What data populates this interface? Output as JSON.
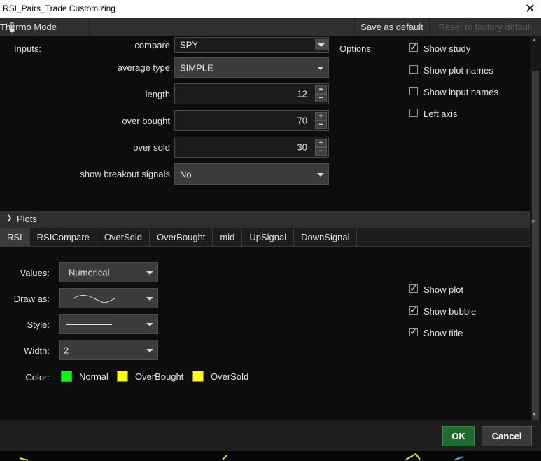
{
  "window": {
    "title": "RSI_Pairs_Trade Customizing",
    "close_glyph": "✕"
  },
  "toolbar": {
    "thermo_label": "Thermo Mode",
    "save_default_label": "Save as default",
    "reset_label": "Reset to factory default"
  },
  "inputs": {
    "section_label": "Inputs:",
    "compare": {
      "label": "compare",
      "value": "SPY"
    },
    "average_type": {
      "label": "average type",
      "value": "SIMPLE"
    },
    "length": {
      "label": "length",
      "value": "12"
    },
    "over_bought": {
      "label": "over bought",
      "value": "70"
    },
    "over_sold": {
      "label": "over sold",
      "value": "30"
    },
    "show_breakout_signals": {
      "label": "show breakout signals",
      "value": "No"
    }
  },
  "options": {
    "section_label": "Options:",
    "items": [
      {
        "label": "Show study",
        "checked": true
      },
      {
        "label": "Show plot names",
        "checked": false
      },
      {
        "label": "Show input names",
        "checked": false
      },
      {
        "label": "Left axis",
        "checked": false
      }
    ]
  },
  "plots": {
    "section_label": "Plots",
    "tabs": [
      "RSI",
      "RSICompare",
      "OverSold",
      "OverBought",
      "mid",
      "UpSignal",
      "DownSignal"
    ],
    "active_tab": "RSI",
    "values_label": "Values:",
    "values_value": "Numerical",
    "draw_as_label": "Draw as:",
    "style_label": "Style:",
    "width_label": "Width:",
    "width_value": "2",
    "color_label": "Color:",
    "colors": [
      {
        "label": "Normal",
        "color": "#00ff00"
      },
      {
        "label": "OverBought",
        "color": "#ffff00"
      },
      {
        "label": "OverSold",
        "color": "#ffff00"
      }
    ],
    "checks": [
      {
        "label": "Show plot",
        "checked": true
      },
      {
        "label": "Show bubble",
        "checked": true
      },
      {
        "label": "Show title",
        "checked": true
      }
    ]
  },
  "footer": {
    "ok_label": "OK",
    "cancel_label": "Cancel"
  },
  "colors": {
    "ok_green": "#1e6b2d",
    "panel": "#2f2f2f",
    "background": "#0d0d0d"
  }
}
